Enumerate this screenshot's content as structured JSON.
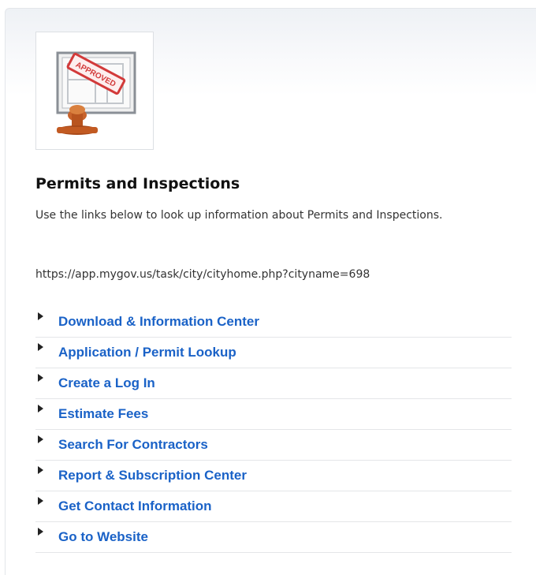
{
  "header": {
    "image_icon": "approved-stamp-icon",
    "stamp_text": "APPROVED",
    "title": "Permits and Inspections",
    "description": "Use the links below to look up information about Permits and Inspections.",
    "url": "https://app.mygov.us/task/city/cityhome.php?cityname=698"
  },
  "links": [
    {
      "label": "Download & Information Center"
    },
    {
      "label": "Application / Permit Lookup"
    },
    {
      "label": "Create a Log In"
    },
    {
      "label": "Estimate Fees"
    },
    {
      "label": "Search For Contractors"
    },
    {
      "label": "Report & Subscription Center"
    },
    {
      "label": "Get Contact Information"
    },
    {
      "label": "Go to Website"
    }
  ],
  "colors": {
    "link": "#1a62c7",
    "stamp_red": "#d23a3a",
    "stamp_handle": "#b8541f"
  }
}
